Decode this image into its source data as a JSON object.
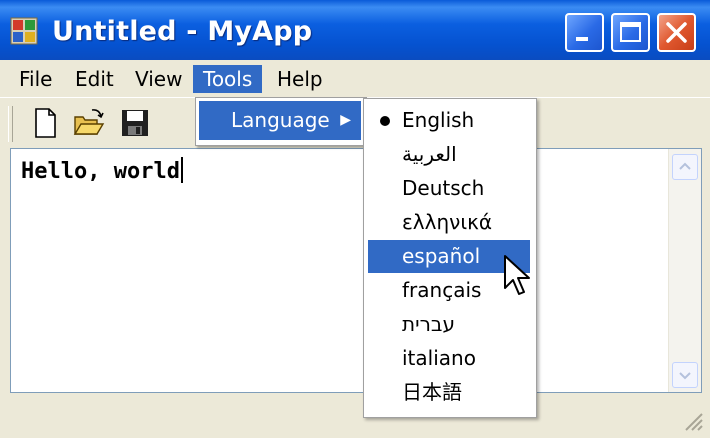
{
  "window": {
    "title": "Untitled - MyApp",
    "controls": [
      "minimize",
      "maximize",
      "close"
    ]
  },
  "menubar": {
    "items": [
      "File",
      "Edit",
      "View",
      "Tools",
      "Help"
    ],
    "active": "Tools"
  },
  "toolbar": {
    "buttons": [
      {
        "icon": "new-document-icon"
      },
      {
        "icon": "open-folder-icon"
      },
      {
        "icon": "save-disk-icon"
      }
    ]
  },
  "editor": {
    "text": "Hello, world"
  },
  "tools_menu": {
    "language_label": "Language",
    "arrow": "▶"
  },
  "language_menu": {
    "selected": "English",
    "hovered": "español",
    "items": [
      "English",
      "العربية",
      "Deutsch",
      "ελληνικά",
      "español",
      "français",
      "עברית",
      "italiano",
      "日本語"
    ]
  },
  "colors": {
    "titlebar": "#0b5fe0",
    "highlight": "#316ac5",
    "close_button": "#e0582f",
    "chrome": "#ece9d8"
  }
}
